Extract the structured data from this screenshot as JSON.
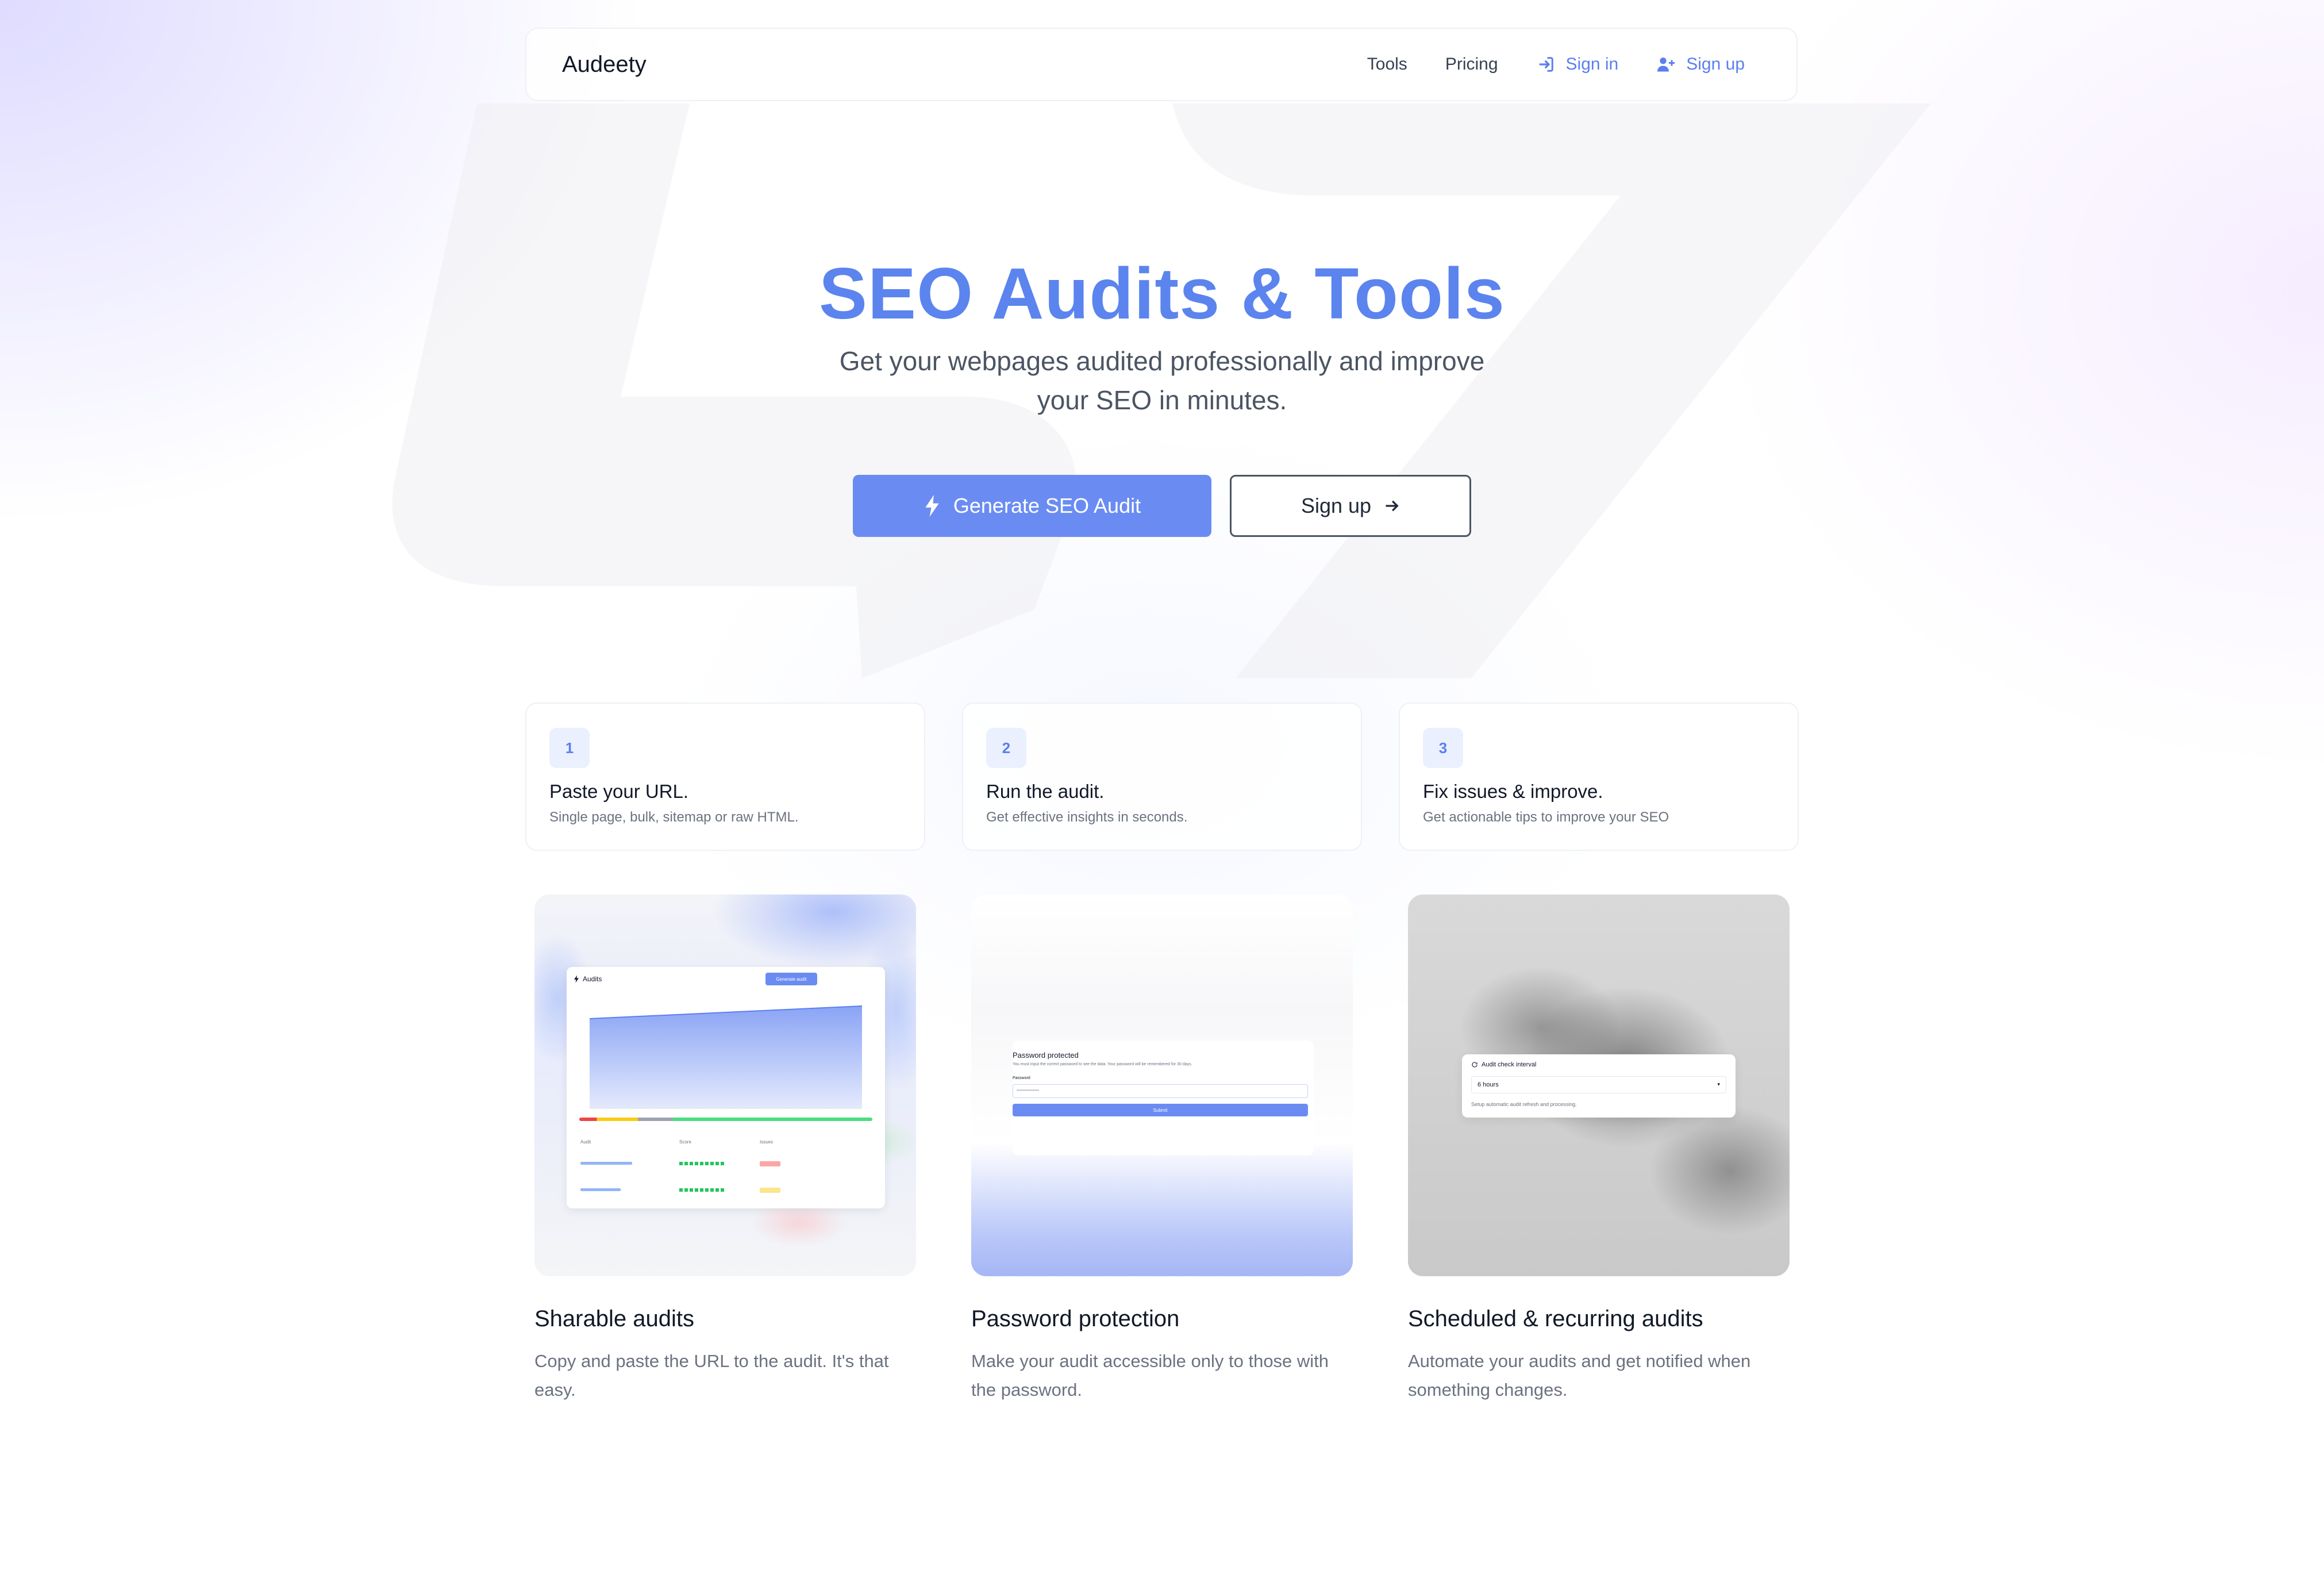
{
  "nav": {
    "brand": "Audeety",
    "links": [
      {
        "label": "Tools"
      },
      {
        "label": "Pricing"
      },
      {
        "label": "Sign in",
        "icon": "sign-in-icon"
      },
      {
        "label": "Sign up",
        "icon": "user-plus-icon"
      }
    ]
  },
  "hero": {
    "title": "SEO Audits & Tools",
    "subtitle": "Get your webpages audited professionally and improve your SEO in minutes.",
    "primary_button": "Generate SEO Audit",
    "primary_icon": "bolt-icon",
    "secondary_button": "Sign up",
    "secondary_icon": "arrow-right-icon"
  },
  "steps": [
    {
      "number": "1",
      "title": "Paste your URL.",
      "description": "Single page, bulk, sitemap or raw HTML."
    },
    {
      "number": "2",
      "title": "Run the audit.",
      "description": "Get effective insights in seconds."
    },
    {
      "number": "3",
      "title": "Fix issues & improve.",
      "description": "Get actionable tips to improve your SEO"
    }
  ],
  "features": [
    {
      "title": "Sharable audits",
      "description": "Copy and paste the URL to the audit. It's that easy.",
      "preview": {
        "header": "Audits",
        "button": "Generate audit",
        "columns": [
          "Audit",
          "Score",
          "Issues"
        ]
      }
    },
    {
      "title": "Password protection",
      "description": "Make your audit accessible only to those with the password.",
      "preview": {
        "heading": "Password protected",
        "note": "You must input the correct password to see the data. Your password will be remembered for 30 days.",
        "field_label": "Password",
        "field_value": "••••••••••••••",
        "submit": "Submit"
      }
    },
    {
      "title": "Scheduled & recurring audits",
      "description": "Automate your audits and get notified when something changes.",
      "preview": {
        "heading": "Audit check interval",
        "selected": "6 hours",
        "note": "Setup automatic audit refresh and processing."
      }
    }
  ],
  "colors": {
    "accent": "#5b84ee",
    "button": "#6a8cf2",
    "step_badge_bg": "#eaf0fe"
  }
}
